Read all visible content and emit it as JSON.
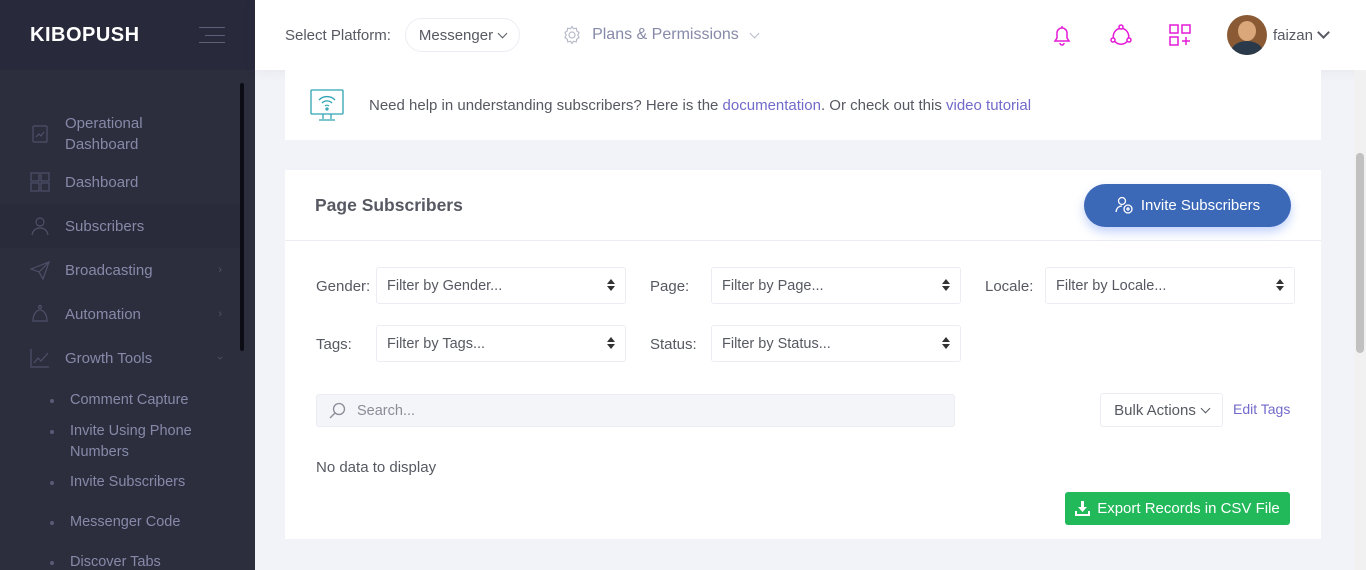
{
  "brand": {
    "name": "KIBOPUSH"
  },
  "sidebar": {
    "items": [
      {
        "label": "Operational Dashboard",
        "icon": "chart-icon"
      },
      {
        "label": "Dashboard",
        "icon": "grid-icon"
      },
      {
        "label": "Subscribers",
        "icon": "user-icon"
      },
      {
        "label": "Broadcasting",
        "icon": "send-icon"
      },
      {
        "label": "Automation",
        "icon": "robot-icon"
      },
      {
        "label": "Growth Tools",
        "icon": "growth-icon"
      }
    ],
    "subitems": [
      "Comment Capture",
      "Invite Using Phone Numbers",
      "Invite Subscribers",
      "Messenger Code",
      "Discover Tabs"
    ]
  },
  "header": {
    "platform_label": "Select Platform:",
    "platform_value": "Messenger",
    "plans_label": "Plans & Permissions",
    "username": "faizan"
  },
  "help": {
    "text_before": "Need help in understanding subscribers? Here is the ",
    "doc_link": "documentation",
    "text_middle": ". Or check out this ",
    "video_link": "video tutorial"
  },
  "panel": {
    "title": "Page Subscribers",
    "invite_button": "Invite Subscribers",
    "filters": {
      "gender_label": "Gender:",
      "gender_value": "Filter by Gender...",
      "page_label": "Page:",
      "page_value": "Filter by Page...",
      "locale_label": "Locale:",
      "locale_value": "Filter by Locale...",
      "tags_label": "Tags:",
      "tags_value": "Filter by Tags...",
      "status_label": "Status:",
      "status_value": "Filter by Status..."
    },
    "search_placeholder": "Search...",
    "bulk_actions": "Bulk Actions",
    "edit_tags": "Edit Tags",
    "empty_text": "No data to display",
    "export_button": "Export Records in CSV File"
  },
  "colors": {
    "sidebar_bg": "#2c2e3e",
    "accent_purple": "#716aca",
    "invite_blue": "#3c68b8",
    "export_green": "#22b95a",
    "header_icon_pink": "#e41bd6"
  }
}
